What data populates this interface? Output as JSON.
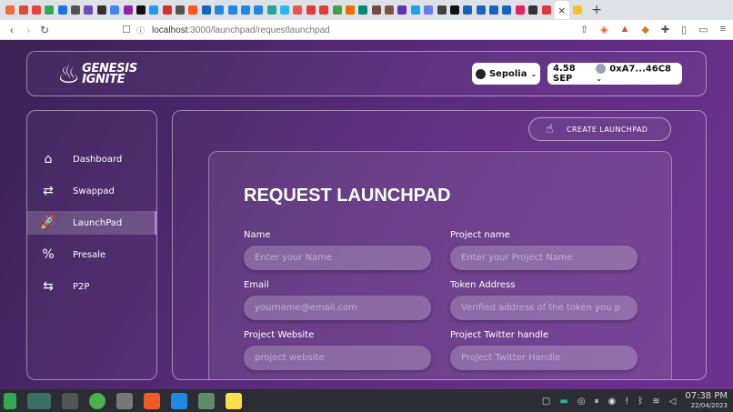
{
  "browser": {
    "tab_colors": [
      "#f06a35",
      "#d94c3a",
      "#e8443a",
      "#34a853",
      "#1a73e8",
      "#555",
      "#6a4fb0",
      "#333",
      "#4285f4",
      "#8e24aa",
      "#111",
      "#2196f3",
      "#d32f2f",
      "#555",
      "#ff5722",
      "#1565c0",
      "#1e88e5",
      "#1e88e5",
      "#1e88e5",
      "#1e88e5",
      "#26a69a",
      "#29b6f6",
      "#ef5350",
      "#e53935",
      "#e53935",
      "#43a047",
      "#ef6c00",
      "#00897b",
      "#6d4c41",
      "#795548",
      "#5e35b1",
      "#1da1f2",
      "#627eea",
      "#424242",
      "#111",
      "#1565c0",
      "#1565c0",
      "#1565c0",
      "#1565c0",
      "#e91e63",
      "#333",
      "#e53935",
      "#fbc02d"
    ],
    "active_tab_close": "×",
    "new_tab": "+",
    "url_host": "localhost",
    "url_rest": ":3000/launchpad/requestlaunchpad"
  },
  "header": {
    "logo_line1": "GENESIS",
    "logo_line2": "IGNITE",
    "network_label": "Sepolia",
    "balance": "4.58 SEP",
    "address": "0xA7...46C8"
  },
  "sidebar": {
    "items": [
      {
        "label": "Dashboard",
        "icon": "home-icon"
      },
      {
        "label": "Swappad",
        "icon": "swap-icon"
      },
      {
        "label": "LaunchPad",
        "icon": "rocket-icon"
      },
      {
        "label": "Presale",
        "icon": "tag-icon"
      },
      {
        "label": "P2P",
        "icon": "p2p-icon"
      }
    ]
  },
  "main": {
    "create_button": "CREATE LAUNCHPAD",
    "form_title": "REQUEST LAUNCHPAD",
    "fields": [
      {
        "label": "Name",
        "placeholder": "Enter your Name"
      },
      {
        "label": "Project name",
        "placeholder": "Enter your Project Name"
      },
      {
        "label": "Email",
        "placeholder": "yourname@email.com"
      },
      {
        "label": "Token Address",
        "placeholder": "Verified address of the token you p"
      },
      {
        "label": "Project Website",
        "placeholder": "project website"
      },
      {
        "label": "Project Twitter handle",
        "placeholder": "Project Twitter Handle"
      }
    ]
  },
  "taskbar": {
    "time": "07:38 PM",
    "date": "22/04/2023"
  }
}
